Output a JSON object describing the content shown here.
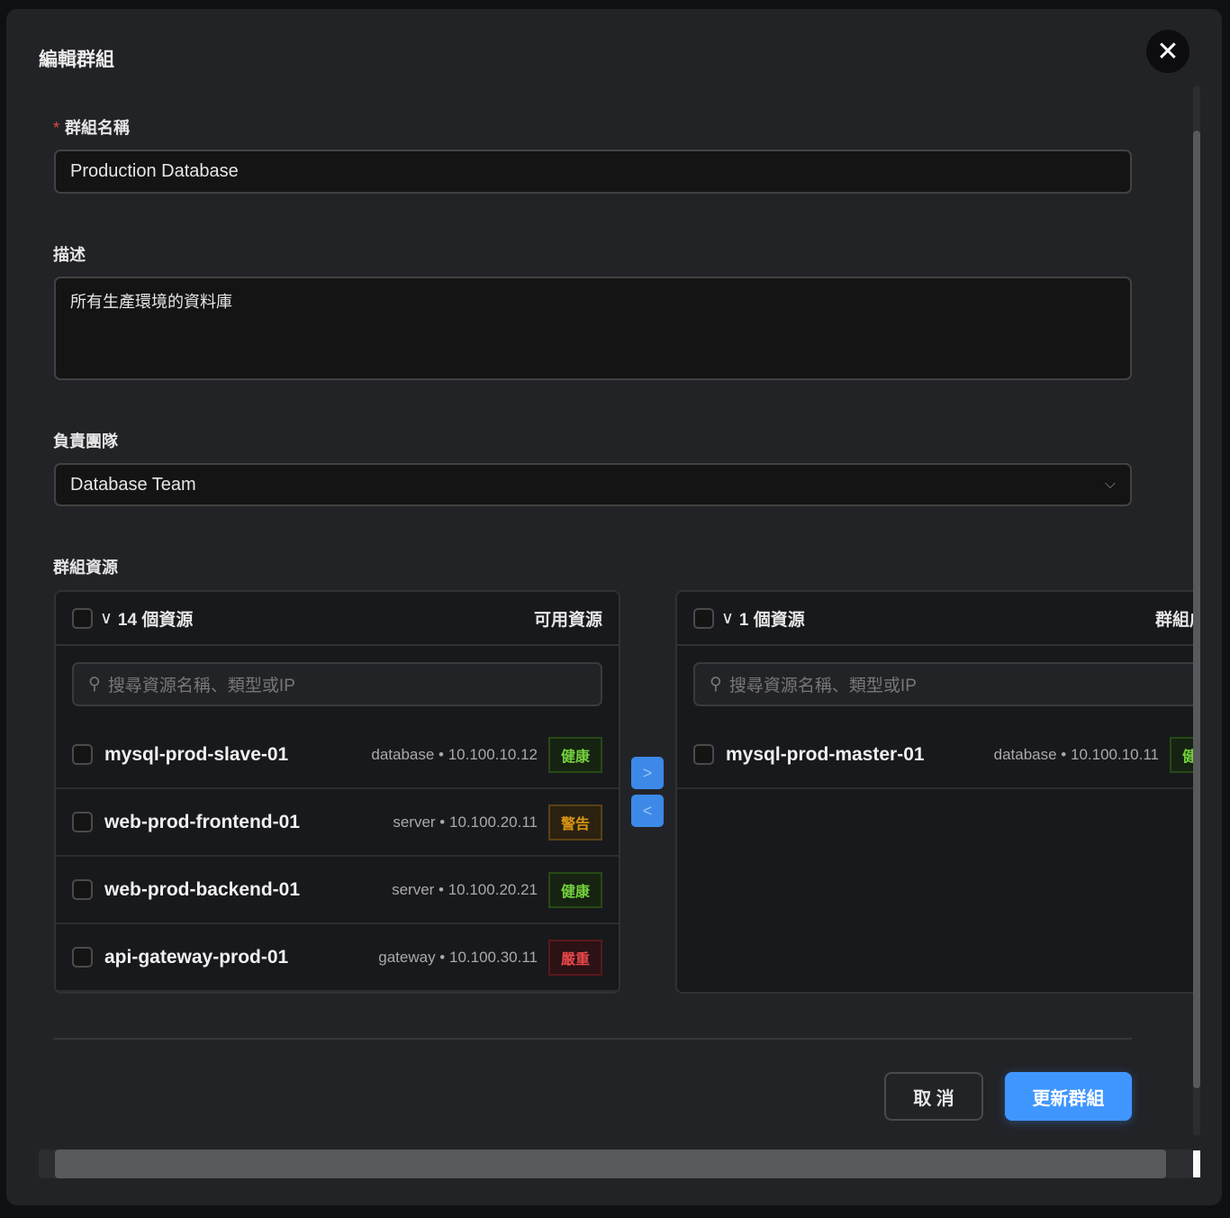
{
  "dialog": {
    "title": "編輯群組",
    "close_icon": "close-icon"
  },
  "form": {
    "name_label": "群組名稱",
    "name_value": "Production Database",
    "desc_label": "描述",
    "desc_value": "所有生產環境的資料庫",
    "team_label": "負責團隊",
    "team_value": "Database Team",
    "resources_label": "群組資源"
  },
  "left_panel": {
    "count": "14 個資源",
    "title": "可用資源",
    "search_placeholder": "搜尋資源名稱、類型或IP",
    "items": [
      {
        "name": "mysql-prod-slave-01",
        "type": "database",
        "ip": "10.100.10.12",
        "status": "健康",
        "level": "healthy"
      },
      {
        "name": "web-prod-frontend-01",
        "type": "server",
        "ip": "10.100.20.11",
        "status": "警告",
        "level": "warning"
      },
      {
        "name": "web-prod-backend-01",
        "type": "server",
        "ip": "10.100.20.21",
        "status": "健康",
        "level": "healthy"
      },
      {
        "name": "api-gateway-prod-01",
        "type": "gateway",
        "ip": "10.100.30.11",
        "status": "嚴重",
        "level": "critical"
      }
    ]
  },
  "right_panel": {
    "count": "1 個資源",
    "title": "群組成員",
    "search_placeholder": "搜尋資源名稱、類型或IP",
    "items": [
      {
        "name": "mysql-prod-master-01",
        "type": "database",
        "ip": "10.100.10.11",
        "status": "健康",
        "level": "healthy"
      }
    ]
  },
  "transfer": {
    "to_right": ">",
    "to_left": "<"
  },
  "footer": {
    "cancel": "取 消",
    "submit": "更新群組"
  },
  "colors": {
    "primary": "#4096ff",
    "healthy": "#73d13d",
    "warning": "#d89614",
    "critical": "#e84749"
  }
}
